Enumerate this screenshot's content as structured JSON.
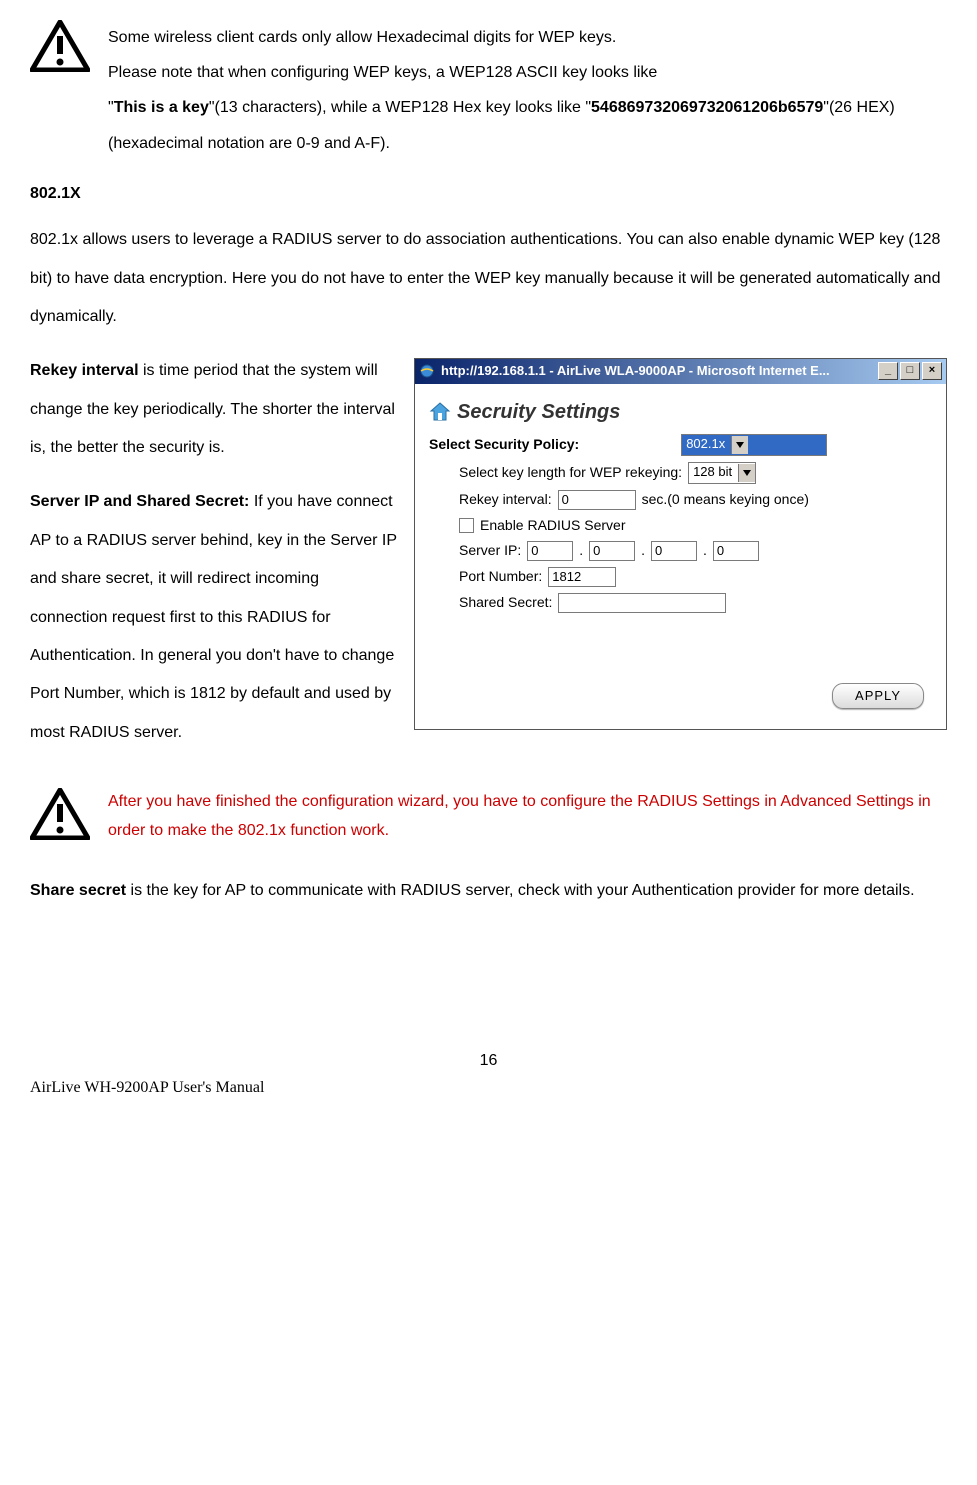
{
  "note1": {
    "line1": "Some wireless client cards only allow Hexadecimal digits for WEP keys.",
    "line2": "Please note that when configuring WEP keys, a WEP128 ASCII key looks like",
    "line3_pre": " \"",
    "line3_bold": "This is a key",
    "line3_mid": "\"(13 characters), while a WEP128 Hex key looks like \"",
    "line3_bold2": "546869732069732061206b6579",
    "line3_post": "\"(26 HEX)",
    "line4": "(hexadecimal notation are 0-9 and A-F)."
  },
  "section": {
    "heading": "802.1X",
    "intro": "802.1x allows users to leverage a RADIUS server to do association authentications. You can also enable dynamic WEP key (128 bit) to have data encryption. Here you do not have to enter the WEP key manually because it will be generated automatically and dynamically.",
    "rekey_bold": "Rekey interval",
    "rekey_rest": " is time period that the system will change the key periodically. The shorter the interval is, the better the security is.",
    "serverip_bold": "Server IP and Shared Secret:",
    "serverip_rest": " If you have connect AP to a RADIUS server behind, key in the Server IP and share secret, it will redirect incoming connection request first to this RADIUS for Authentication. In general you don't have to change Port Number, which is 1812 by default and used by most RADIUS server."
  },
  "warn2": "After you have finished the configuration wizard, you have to configure the RADIUS Settings in Advanced Settings in order to make the 802.1x function work.",
  "share_bold": "Share secret",
  "share_rest": " is the key for AP to communicate with RADIUS server, check with your Authentication provider for more details.",
  "window": {
    "title": "http://192.168.1.1 - AirLive WLA-9000AP - Microsoft Internet E...",
    "panel_title": "Secruity Settings",
    "policy_label": "Select Security Policy:",
    "policy_value": "802.1x",
    "keylen_label": "Select key length for WEP rekeying:",
    "keylen_value": "128 bit",
    "rekey_label": "Rekey interval:",
    "rekey_value": "0",
    "rekey_suffix": "sec.(0 means keying once)",
    "enable_radius": "Enable RADIUS Server",
    "serverip_label": "Server IP:",
    "ip1": "0",
    "ip2": "0",
    "ip3": "0",
    "ip4": "0",
    "port_label": "Port Number:",
    "port_value": "1812",
    "secret_label": "Shared Secret:",
    "secret_value": "",
    "apply": "APPLY"
  },
  "footer": {
    "page": "16",
    "manual": "AirLive WH-9200AP User's Manual"
  }
}
